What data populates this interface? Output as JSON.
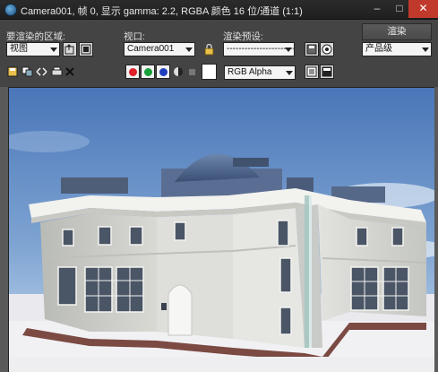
{
  "window": {
    "title": "Camera001, 帧 0, 显示 gamma: 2.2, RGBA 颜色 16 位/通道 (1:1)",
    "minimize": "–",
    "maximize": "□",
    "close": "✕"
  },
  "toolbar": {
    "area_label": "要渲染的区域:",
    "area_value": "视图",
    "viewport_label": "视口:",
    "viewport_value": "Camera001",
    "preset_label": "渲染预设:",
    "preset_value": "-------------------------",
    "render_button": "渲染",
    "quality_value": "产品级",
    "channel_value": "RGB Alpha"
  },
  "channels": {
    "red": "#e0202a",
    "green": "#1aa23a",
    "blue": "#1f3fc0"
  },
  "icons": {
    "edit_region": "edit-region-icon",
    "auto_region": "auto-region-icon",
    "lock": "lock-icon",
    "preset_save": "save-preset-icon",
    "preset_env": "environment-icon",
    "save_image": "save-image-icon",
    "copy_image": "copy-image-icon",
    "clone_window": "clone-window-icon",
    "print": "print-icon",
    "clear": "clear-icon",
    "mono": "monochrome-icon",
    "swatch": "color-swatch-icon",
    "display_channel": "display-channel-icon",
    "toggle_ui": "toggle-ui-icon"
  },
  "colors": {
    "sky_top": "#4a76b8",
    "sky_bottom": "#c9dcef",
    "ground": "#e9e9ee",
    "building": "#cfcfc9"
  }
}
